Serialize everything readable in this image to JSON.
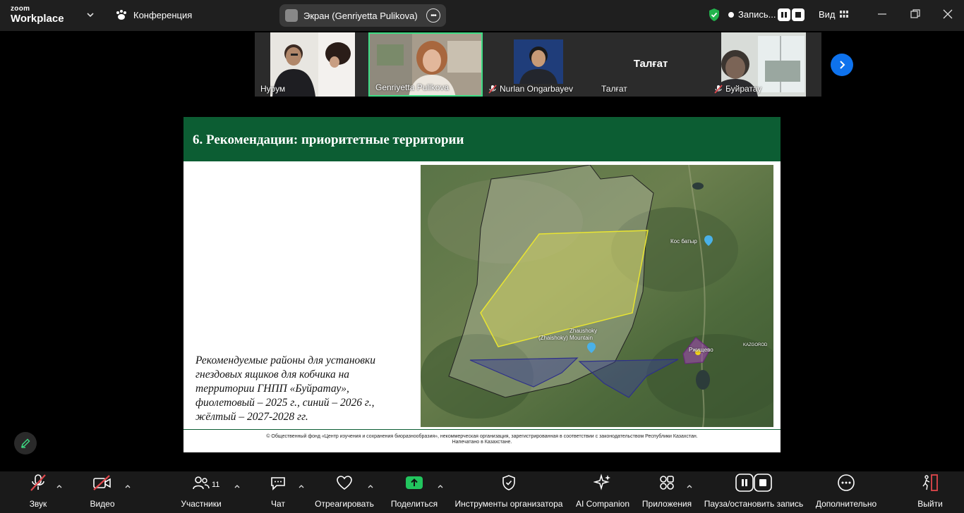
{
  "app": {
    "logo_top": "zoom",
    "logo_bottom": "Workplace"
  },
  "header": {
    "conference_label": "Конференция",
    "screen_share_label": "Экран (Genriyetta Pulikova)",
    "recording_label": "Запись...",
    "view_label": "Вид"
  },
  "participants": [
    {
      "name": "Нурум",
      "muted": false
    },
    {
      "name": "Genriyetta Pulikova",
      "muted": false,
      "active": true
    },
    {
      "name": "Nurlan Ongarbayev",
      "muted": true
    },
    {
      "name": "Талғат",
      "muted": false,
      "display_name_center": "Талғат"
    },
    {
      "name": "Буйратау",
      "muted": true
    }
  ],
  "slide": {
    "title": "6. Рекомендации: приоритетные территории",
    "text": "Рекомендуемые районы для установки гнездовых ящиков для кобчика на территории ГНПП «Буйратау», фиолетовый – 2025 г., синий – 2026 г., жёлтый – 2027-2028 гг.",
    "footer": "© Общественный фонд «Центр изучения и сохранения биоразнообразия», некоммерческая организация, зарегистрированная в соответствии с законодательством Республики Казахстан. Напечатано в Казахстане.",
    "map_labels": {
      "kos_batyr": "Кос батыр",
      "mountain_1": "Zhaushoky",
      "mountain_2": "(Zhaishoky) Mountain",
      "town": "Ржищево",
      "kazgorod": "KAZGOROD"
    }
  },
  "toolbar": {
    "audio": "Звук",
    "video": "Видео",
    "participants": "Участники",
    "participants_count": "11",
    "chat": "Чат",
    "react": "Отреагировать",
    "share": "Поделиться",
    "host_tools": "Инструменты организатора",
    "ai_companion": "AI Companion",
    "apps": "Приложения",
    "pause_stop_recording": "Пауза/остановить запись",
    "more": "Дополнительно",
    "leave": "Выйти"
  },
  "colors": {
    "accent_green": "#3ddc84",
    "slide_green": "#0c5d33",
    "blue_button": "#0e72ed",
    "leave_red": "#e0474c"
  }
}
